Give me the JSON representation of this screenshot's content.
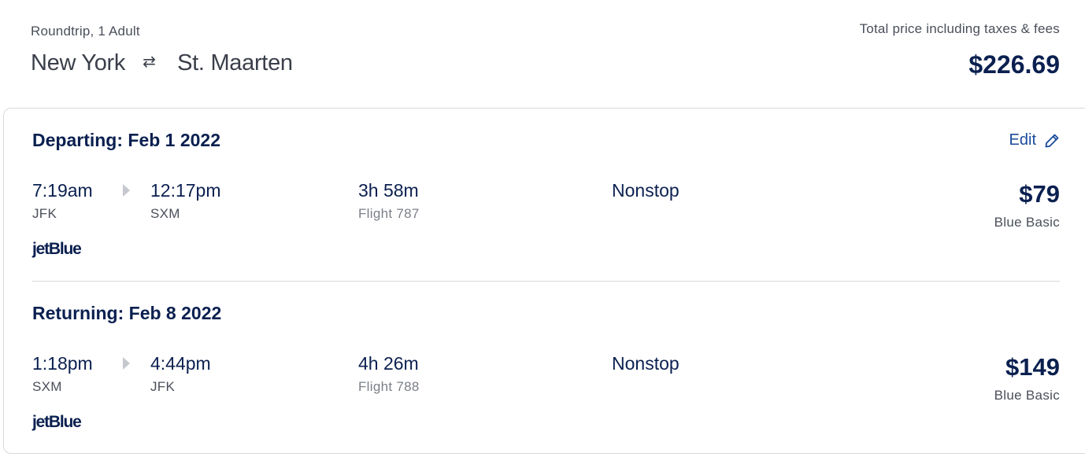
{
  "header": {
    "trip_meta": "Roundtrip, 1 Adult",
    "origin": "New York",
    "swap_icon": "⇄",
    "destination": "St. Maarten",
    "price_label": "Total price including taxes & fees",
    "total_price": "$226.69"
  },
  "edit": {
    "label": "Edit",
    "icon": "pencil-icon"
  },
  "legs": [
    {
      "title": "Departing: Feb 1 2022",
      "depart_time": "7:19am",
      "depart_code": "JFK",
      "arrive_time": "12:17pm",
      "arrive_code": "SXM",
      "duration": "3h 58m",
      "flight": "Flight 787",
      "stops": "Nonstop",
      "price": "$79",
      "fare": "Blue Basic",
      "airline": "jetBlue"
    },
    {
      "title": "Returning: Feb 8 2022",
      "depart_time": "1:18pm",
      "depart_code": "SXM",
      "arrive_time": "4:44pm",
      "arrive_code": "JFK",
      "duration": "4h 26m",
      "flight": "Flight 788",
      "stops": "Nonstop",
      "price": "$149",
      "fare": "Blue Basic",
      "airline": "jetBlue"
    }
  ],
  "colors": {
    "navy": "#0b2050",
    "link": "#1a4a9c",
    "muted": "#4a4f5a",
    "border": "#d7d9de"
  }
}
